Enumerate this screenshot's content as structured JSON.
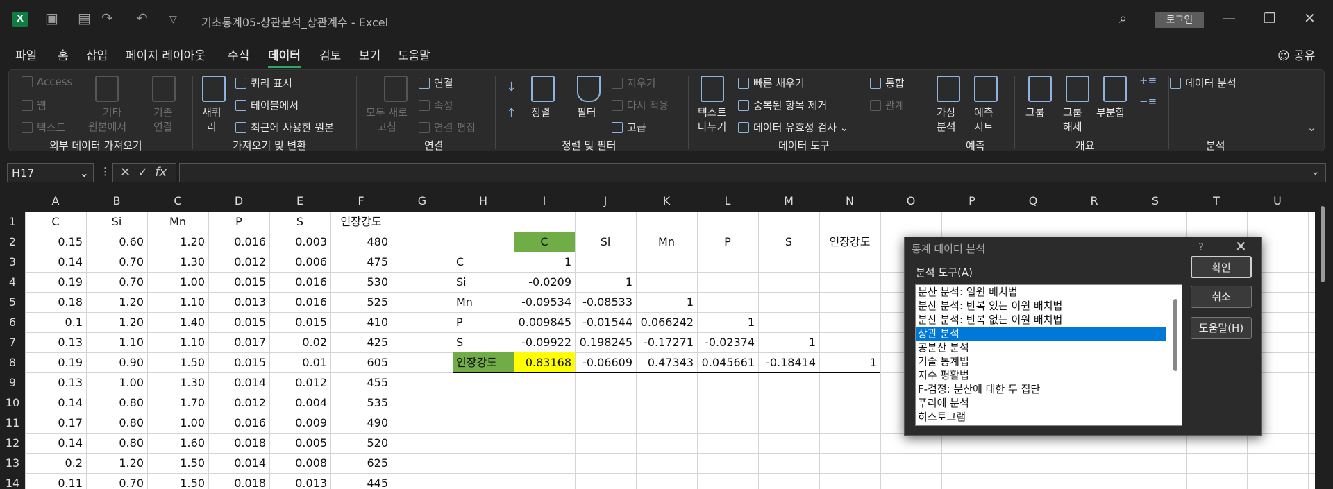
{
  "window": {
    "title": "기초통계05-상관분석_상관계수  -  Excel",
    "login": "로그인",
    "share": "공유"
  },
  "tabs": [
    "파일",
    "홈",
    "삽입",
    "페이지 레이아웃",
    "수식",
    "데이터",
    "검토",
    "보기",
    "도움말"
  ],
  "ribbon": {
    "get_external": {
      "label": "외부 데이터 가져오기",
      "access": "Access",
      "web": "웹",
      "text": "텍스트",
      "other1": "기타",
      "other2": "원본에서",
      "existing1": "기존",
      "existing2": "연결"
    },
    "transform": {
      "label": "가져오기 및 변환",
      "new1": "새쿼",
      "new2": "리",
      "show_query": "쿼리 표시",
      "from_table": "테이블에서",
      "recent": "최근에 사용한 원본"
    },
    "connections": {
      "label": "연결",
      "refresh1": "모두 새로",
      "refresh2": "고침",
      "connections": "연결",
      "properties": "속성",
      "edit_links": "연결 편집"
    },
    "sort_filter": {
      "label": "정렬 및 필터",
      "sort": "정렬",
      "filter": "필터",
      "clear": "지우기",
      "reapply": "다시 적용",
      "advanced": "고급"
    },
    "data_tools": {
      "label": "데이터 도구",
      "text_to_cols1": "텍스트",
      "text_to_cols2": "나누기",
      "flash_fill": "빠른 채우기",
      "remove_dup": "중복된 항목 제거",
      "validation": "데이터 유효성 검사",
      "consolidate": "통합",
      "relations": "관계"
    },
    "forecast": {
      "label": "예측",
      "whatif1": "가상",
      "whatif2": "분석",
      "sheet1": "예측",
      "sheet2": "시트"
    },
    "outline": {
      "label": "개요",
      "group": "그룹",
      "ungroup1": "그룹",
      "ungroup2": "해제",
      "subtotal": "부분합"
    },
    "analysis": {
      "label": "분석",
      "data_analysis": "데이터 분석"
    }
  },
  "formula_bar": {
    "name_box": "H17",
    "fx": "fx"
  },
  "columns": [
    "A",
    "B",
    "C",
    "D",
    "E",
    "F",
    "G",
    "H",
    "I",
    "J",
    "K",
    "L",
    "M",
    "N",
    "O",
    "P",
    "Q",
    "R",
    "S",
    "T",
    "U"
  ],
  "rows": [
    "1",
    "2",
    "3",
    "4",
    "5",
    "6",
    "7",
    "8",
    "9",
    "10",
    "11",
    "12",
    "13",
    "14"
  ],
  "data_table": {
    "headers": [
      "C",
      "Si",
      "Mn",
      "P",
      "S",
      "인장강도"
    ],
    "rows": [
      [
        "0.15",
        "0.60",
        "1.20",
        "0.016",
        "0.003",
        "480"
      ],
      [
        "0.14",
        "0.70",
        "1.30",
        "0.012",
        "0.006",
        "475"
      ],
      [
        "0.19",
        "0.70",
        "1.00",
        "0.015",
        "0.016",
        "530"
      ],
      [
        "0.18",
        "1.20",
        "1.10",
        "0.013",
        "0.016",
        "525"
      ],
      [
        "0.1",
        "1.20",
        "1.40",
        "0.015",
        "0.015",
        "410"
      ],
      [
        "0.13",
        "1.10",
        "1.10",
        "0.017",
        "0.02",
        "425"
      ],
      [
        "0.19",
        "0.90",
        "1.50",
        "0.015",
        "0.01",
        "605"
      ],
      [
        "0.13",
        "1.00",
        "1.30",
        "0.014",
        "0.012",
        "455"
      ],
      [
        "0.14",
        "0.80",
        "1.70",
        "0.012",
        "0.004",
        "535"
      ],
      [
        "0.17",
        "0.80",
        "1.00",
        "0.016",
        "0.009",
        "490"
      ],
      [
        "0.14",
        "0.80",
        "1.60",
        "0.018",
        "0.005",
        "520"
      ],
      [
        "0.2",
        "1.20",
        "1.50",
        "0.014",
        "0.008",
        "625"
      ],
      [
        "0.11",
        "0.70",
        "1.50",
        "0.018",
        "0.013",
        "445"
      ]
    ]
  },
  "corr_table": {
    "headers": [
      "C",
      "Si",
      "Mn",
      "P",
      "S",
      "인장강도"
    ],
    "row_labels": [
      "C",
      "Si",
      "Mn",
      "P",
      "S",
      "인장강도"
    ],
    "rows": [
      [
        "1",
        "",
        "",
        "",
        "",
        ""
      ],
      [
        "-0.0209",
        "1",
        "",
        "",
        "",
        ""
      ],
      [
        "-0.09534",
        "-0.08533",
        "1",
        "",
        "",
        ""
      ],
      [
        "0.009845",
        "-0.01544",
        "0.066242",
        "1",
        "",
        ""
      ],
      [
        "-0.09922",
        "0.198245",
        "-0.17271",
        "-0.02374",
        "1",
        ""
      ],
      [
        "0.83168",
        "-0.06609",
        "0.47343",
        "0.045661",
        "-0.18414",
        "1"
      ]
    ],
    "header_highlight": "#70ad47",
    "cell_highlight": "#ffff00"
  },
  "dialog": {
    "title": "통계 데이터 분석",
    "help": "?",
    "list_label": "분석 도구(A)",
    "tools": [
      "분산 분석: 일원 배치법",
      "분산 분석: 반복 있는 이원 배치법",
      "분산 분석: 반복 없는 이원 배치법",
      "상관 분석",
      "공분산 분석",
      "기술 통계법",
      "지수 평활법",
      "F-검정: 분산에 대한 두 집단",
      "푸리에 분석",
      "히스토그램"
    ],
    "selected_tool": "상관 분석",
    "ok": "확인",
    "cancel": "취소",
    "help_btn": "도움말(H)"
  }
}
